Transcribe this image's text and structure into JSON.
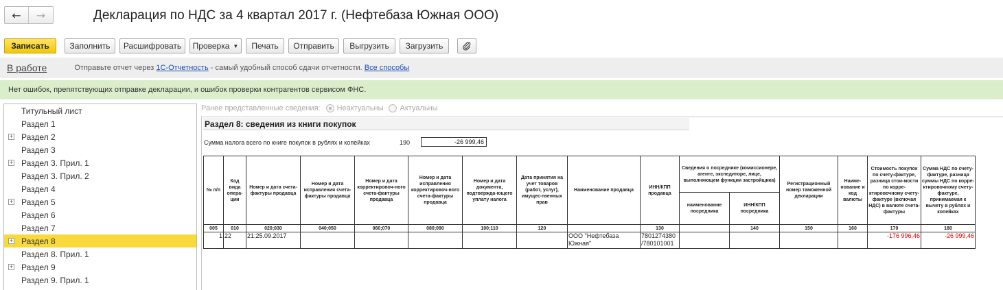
{
  "header": {
    "back_icon": "←",
    "forward_icon": "→",
    "title": "Декларация по НДС за 4 квартал 2017 г. (Нефтебаза Южная ООО)"
  },
  "toolbar": {
    "save": "Записать",
    "fill": "Заполнить",
    "decode": "Расшифровать",
    "check": "Проверка",
    "print": "Печать",
    "send": "Отправить",
    "export": "Выгрузить",
    "import": "Загрузить",
    "attach_icon": "paperclip-icon"
  },
  "status": {
    "state": "В работе",
    "msg_prefix": "Отправьте отчет через ",
    "link1": "1С-Отчетность",
    "msg_middle": " - самый удобный способ сдачи отчетности. ",
    "link2": "Все способы"
  },
  "ok_message": "Нет ошибок, препятствующих отправке декларации, и ошибок проверки контрагентов сервисом ФНС.",
  "tree": {
    "items": [
      {
        "label": "Титульный лист",
        "expandable": false,
        "selected": false
      },
      {
        "label": "Раздел 1",
        "expandable": false,
        "selected": false
      },
      {
        "label": "Раздел 2",
        "expandable": true,
        "selected": false
      },
      {
        "label": "Раздел 3",
        "expandable": false,
        "selected": false
      },
      {
        "label": "Раздел 3. Прил. 1",
        "expandable": true,
        "selected": false
      },
      {
        "label": "Раздел 3. Прил. 2",
        "expandable": false,
        "selected": false
      },
      {
        "label": "Раздел 4",
        "expandable": false,
        "selected": false
      },
      {
        "label": "Раздел 5",
        "expandable": true,
        "selected": false
      },
      {
        "label": "Раздел 6",
        "expandable": false,
        "selected": false
      },
      {
        "label": "Раздел 7",
        "expandable": false,
        "selected": false
      },
      {
        "label": "Раздел 8",
        "expandable": true,
        "selected": true
      },
      {
        "label": "Раздел 8. Прил. 1",
        "expandable": false,
        "selected": false
      },
      {
        "label": "Раздел 9",
        "expandable": true,
        "selected": false
      },
      {
        "label": "Раздел 9. Прил. 1",
        "expandable": false,
        "selected": false
      }
    ]
  },
  "prev_info": {
    "label": "Ранее представленные сведения:",
    "opt1": "Неактуальны",
    "opt2": "Актуальны"
  },
  "section": {
    "title": "Раздел 8: сведения из книги покупок",
    "sum_label": "Сумма налога всего по книге покупок в рублях и копейках",
    "sum_code": "190",
    "sum_value": "-26 999,46"
  },
  "table": {
    "h_np": "№ п/п",
    "h_code": "Код вида опера-ции",
    "h_inv": "Номер и дата счета-фактуры продавца",
    "h_inv_fix": "Номер и дата исправления счета-фактуры продавца",
    "h_corr": "Номер и дата корректировоч-ного счета-фактуры продавца",
    "h_corr_fix": "Номер и дата исправления корректировоч-ного счета-фактуры продавца",
    "h_pay_doc": "Номер и дата документа, подтвержда-ющего уплату налога",
    "h_accept": "Дата принятия на учет товаров (работ, услуг), имущес-твенных прав",
    "h_seller": "Наименование продавца",
    "h_inn": "ИНН/КПП продавца",
    "h_agent": "Сведения о посреднике (комиссионере, агенте, экспедиторе, лице, выполняющем функции застройщика)",
    "h_agent_name": "наименование посредника",
    "h_agent_inn": "ИНН/КПП посредника",
    "h_customs": "Регистрационный номер таможенной декларации",
    "h_currency": "Наиме-нование и код валюты",
    "h_cost": "Стоимость покупок по счету-фактуре, разница стои-мости по корре-ктировочному счету-фактуре (включая НДС) в валюте счета-фактуры",
    "h_vat": "Сумма НДС по счету-фактуре, разница суммы НДС по корре-ктировочному счету-фактуре, принимаемая к вычету в рублях и копейках",
    "codes": [
      "005",
      "010",
      "020;030",
      "040;050",
      "060;070",
      "080;090",
      "100;110",
      "120",
      "",
      "130",
      "",
      "140",
      "150",
      "160",
      "170",
      "180"
    ],
    "rows": [
      {
        "np": "1",
        "code": "22",
        "inv": "21;25.09.2017",
        "inv_fix": "",
        "corr": "",
        "corr_fix": "",
        "pay_doc": "",
        "accept": "",
        "seller": "ООО \"Нефтебаза Южная\"",
        "inn": "7801274380 /780101001",
        "agent_name": "",
        "agent_inn": "",
        "customs": "",
        "currency": "",
        "cost": "-176 996,46",
        "vat": "-26 999,46"
      }
    ]
  },
  "colors": {
    "accent_yellow": "#f9da3b",
    "ok_green": "#dbeecc",
    "negative_red": "#e00000",
    "link_blue": "#1a4fb4"
  }
}
